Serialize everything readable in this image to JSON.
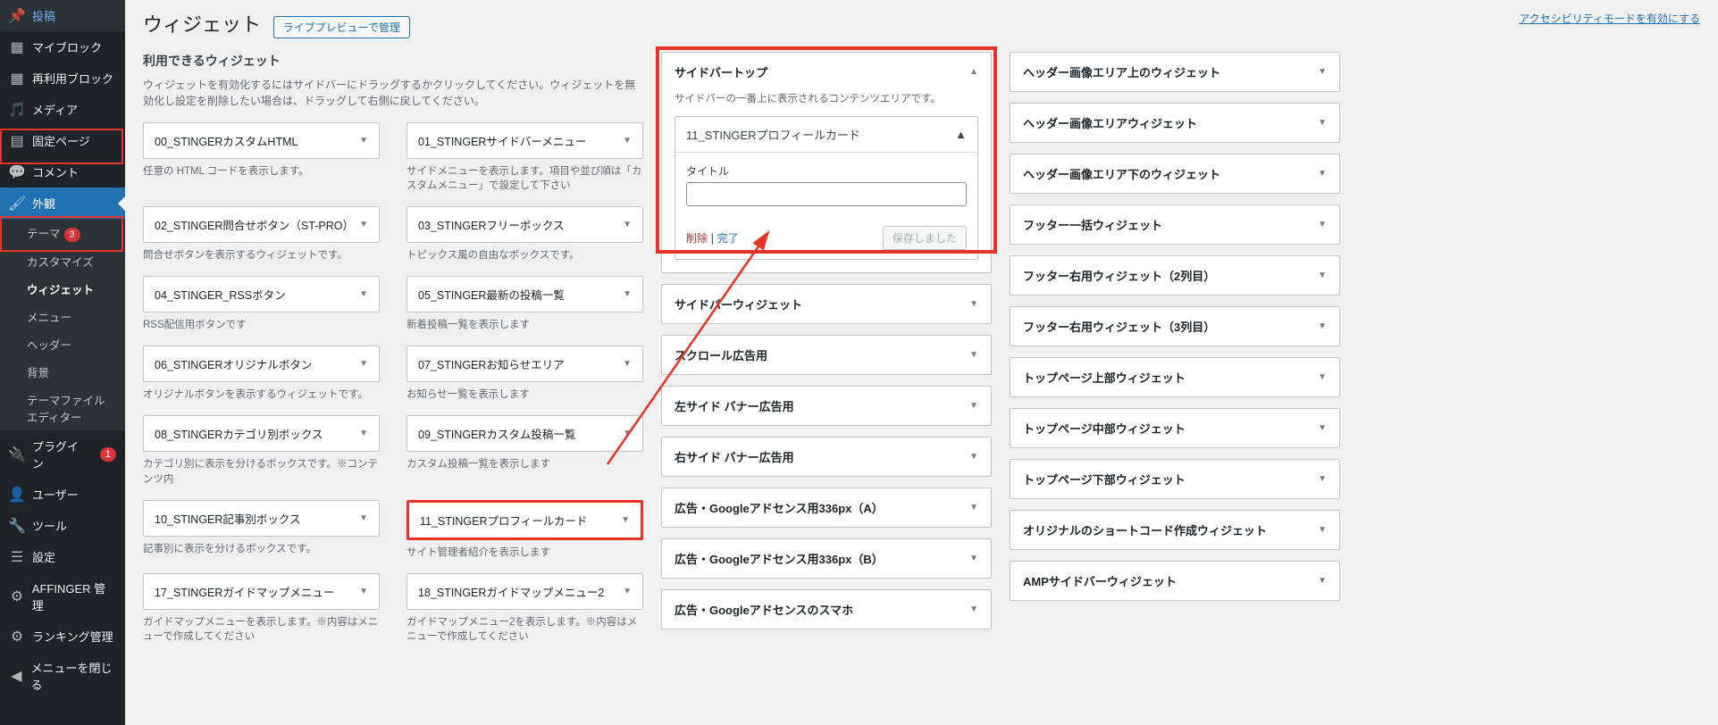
{
  "top_link": "アクセシビリティモードを有効にする",
  "page_title": "ウィジェット",
  "live_preview_btn": "ライブプレビューで管理",
  "sidebar": {
    "items": [
      {
        "icon": "pin",
        "label": "投稿"
      },
      {
        "icon": "grid",
        "label": "マイブロック"
      },
      {
        "icon": "grid",
        "label": "再利用ブロック"
      },
      {
        "icon": "media",
        "label": "メディア"
      },
      {
        "icon": "page",
        "label": "固定ページ"
      },
      {
        "icon": "comment",
        "label": "コメント"
      },
      {
        "icon": "brush",
        "label": "外観",
        "current": true
      },
      {
        "icon": "plug",
        "label": "プラグイン",
        "badge": "1"
      },
      {
        "icon": "user",
        "label": "ユーザー"
      },
      {
        "icon": "wrench",
        "label": "ツール"
      },
      {
        "icon": "sliders",
        "label": "設定"
      },
      {
        "icon": "gear",
        "label": "AFFINGER 管理"
      },
      {
        "icon": "gear",
        "label": "ランキング管理"
      },
      {
        "icon": "collapse",
        "label": "メニューを閉じる"
      }
    ],
    "submenu": [
      {
        "label": "テーマ",
        "badge": "3"
      },
      {
        "label": "カスタマイズ"
      },
      {
        "label": "ウィジェット",
        "current": true
      },
      {
        "label": "メニュー"
      },
      {
        "label": "ヘッダー"
      },
      {
        "label": "背景"
      },
      {
        "label": "テーマファイルエディター"
      }
    ]
  },
  "available": {
    "heading": "利用できるウィジェット",
    "desc": "ウィジェットを有効化するにはサイドバーにドラッグするかクリックしてください。ウィジェットを無効化し設定を削除したい場合は、ドラッグして右側に戻してください。",
    "items": [
      {
        "t": "00_STINGERカスタムHTML",
        "d": "任意の HTML コードを表示します。"
      },
      {
        "t": "01_STINGERサイドバーメニュー",
        "d": "サイドメニューを表示します。項目や並び順は「カスタムメニュー」で設定して下さい"
      },
      {
        "t": "02_STINGER問合せボタン（ST-PRO）",
        "d": "問合せボタンを表示するウィジェットです。"
      },
      {
        "t": "03_STINGERフリーボックス",
        "d": "トピックス風の自由なボックスです。"
      },
      {
        "t": "04_STINGER_RSSボタン",
        "d": "RSS配信用ボタンです"
      },
      {
        "t": "05_STINGER最新の投稿一覧",
        "d": "新着投稿一覧を表示します"
      },
      {
        "t": "06_STINGERオリジナルボタン",
        "d": "オリジナルボタンを表示するウィジェットです。"
      },
      {
        "t": "07_STINGERお知らせエリア",
        "d": "お知らせ一覧を表示します"
      },
      {
        "t": "08_STINGERカテゴリ別ボックス",
        "d": "カテゴリ別に表示を分けるボックスです。※コンテンツ内"
      },
      {
        "t": "09_STINGERカスタム投稿一覧",
        "d": "カスタム投稿一覧を表示します"
      },
      {
        "t": "10_STINGER記事別ボックス",
        "d": "記事別に表示を分けるボックスです。"
      },
      {
        "t": "11_STINGERプロフィールカード",
        "d": "サイト管理者紹介を表示します",
        "highlight": true
      },
      {
        "t": "17_STINGERガイドマップメニュー",
        "d": "ガイドマップメニューを表示します。※内容はメニューで作成してください"
      },
      {
        "t": "18_STINGERガイドマップメニュー2",
        "d": "ガイドマップメニュー2を表示します。※内容はメニューで作成してください"
      }
    ]
  },
  "mid_areas": {
    "open": {
      "title": "サイドバートップ",
      "desc": "サイドバーの一番上に表示されるコンテンツエリアです。",
      "widget_title": "11_STINGERプロフィールカード",
      "field_label": "タイトル",
      "field_value": "",
      "delete": "削除",
      "done": "完了",
      "saved": "保存しました"
    },
    "closed": [
      "サイドバーウィジェット",
      "スクロール広告用",
      "左サイド バナー広告用",
      "右サイド バナー広告用",
      "広告・Googleアドセンス用336px（A）",
      "広告・Googleアドセンス用336px（B）",
      "広告・Googleアドセンスのスマホ"
    ]
  },
  "right_areas": [
    "ヘッダー画像エリア上のウィジェット",
    "ヘッダー画像エリアウィジェット",
    "ヘッダー画像エリア下のウィジェット",
    "フッター一括ウィジェット",
    "フッター右用ウィジェット（2列目）",
    "フッター右用ウィジェット（3列目）",
    "トップページ上部ウィジェット",
    "トップページ中部ウィジェット",
    "トップページ下部ウィジェット",
    "オリジナルのショートコード作成ウィジェット",
    "AMPサイドバーウィジェット"
  ]
}
